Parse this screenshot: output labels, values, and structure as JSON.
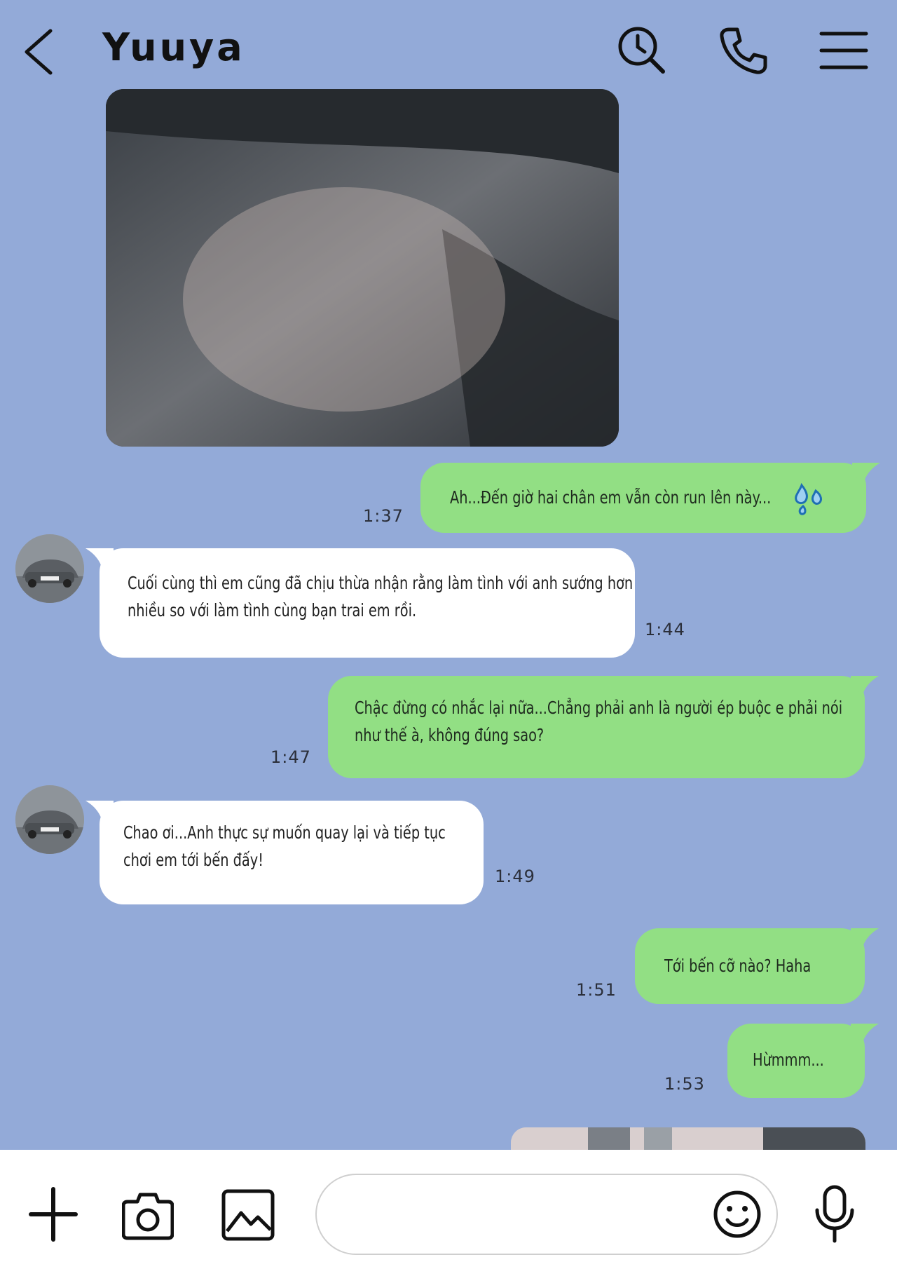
{
  "header": {
    "title": "Yuuya",
    "back_icon": "chevron-left-icon",
    "search_icon": "clock-search-icon",
    "call_icon": "phone-icon",
    "menu_icon": "hamburger-menu-icon"
  },
  "colors": {
    "background": "#93aad8",
    "outgoing_bubble": "#92df84",
    "incoming_bubble": "#ffffff",
    "toolbar": "#ffffff"
  },
  "messages": [
    {
      "direction": "in",
      "type": "image",
      "content": "photo attachment"
    },
    {
      "direction": "out",
      "lines": [
        "Ah...Đến giờ hai chân em vẫn còn run lên này..."
      ],
      "time": "1:37",
      "emoji": "sweat-droplets-icon"
    },
    {
      "direction": "in",
      "lines": [
        "Cuối cùng thì em cũng đã chịu thừa nhận rằng làm tình với anh sướng hơn",
        "nhiều so với làm tình cùng bạn trai em rồi."
      ],
      "time": "1:44"
    },
    {
      "direction": "out",
      "lines": [
        "Chậc đừng có nhắc lại nữa...Chẳng phải anh là người ép buộc e phải nói",
        "như thế à, không đúng sao?"
      ],
      "time": "1:47"
    },
    {
      "direction": "in",
      "lines": [
        "Chao ơi...Anh thực sự muốn quay lại và tiếp tục",
        "chơi em tới bến đấy!"
      ],
      "time": "1:49"
    },
    {
      "direction": "out",
      "lines": [
        "Tới bến cỡ nào? Haha"
      ],
      "time": "1:51"
    },
    {
      "direction": "out",
      "lines": [
        "Hừmmm..."
      ],
      "time": "1:53"
    }
  ],
  "toolbar": {
    "add_icon": "plus-icon",
    "camera_icon": "camera-icon",
    "gallery_icon": "image-icon",
    "input_value": "",
    "input_placeholder": "",
    "emoji_icon": "smiley-icon",
    "mic_icon": "microphone-icon"
  }
}
